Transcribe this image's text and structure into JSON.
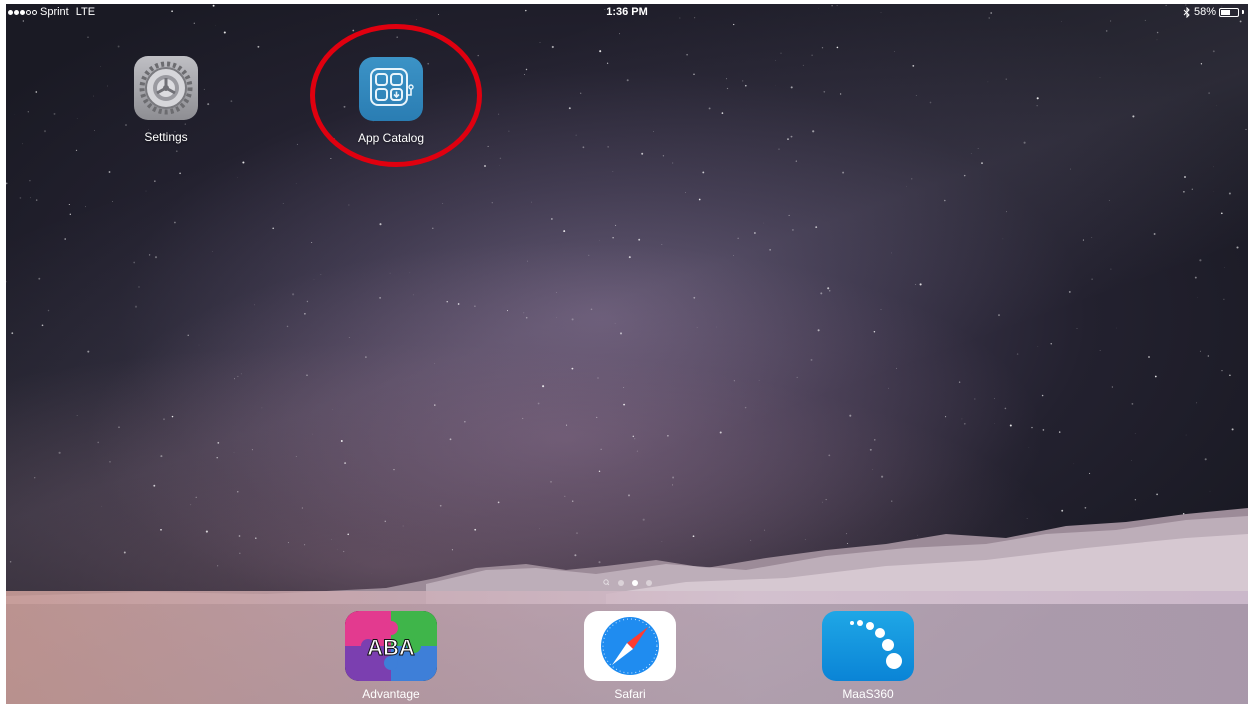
{
  "status_bar": {
    "carrier": "Sprint",
    "network": "LTE",
    "signal_bars_filled": 3,
    "signal_bars_total": 5,
    "time": "1:36 PM",
    "bluetooth_icon": "bluetooth-icon",
    "battery_percent": "58%",
    "battery_level": 0.58
  },
  "home": {
    "apps": [
      {
        "label": "Settings",
        "icon": "gear-icon"
      },
      {
        "label": "App Catalog",
        "icon": "app-catalog-icon"
      }
    ],
    "highlight_color": "#e0000f",
    "page_indicator": {
      "pages": 3,
      "active_page": 2,
      "has_search_page": true
    }
  },
  "dock": {
    "apps": [
      {
        "label": "Advantage",
        "icon": "aba-puzzle-icon",
        "icon_text": "ABA"
      },
      {
        "label": "Safari",
        "icon": "compass-icon"
      },
      {
        "label": "MaaS360",
        "icon": "maas360-icon"
      }
    ]
  }
}
